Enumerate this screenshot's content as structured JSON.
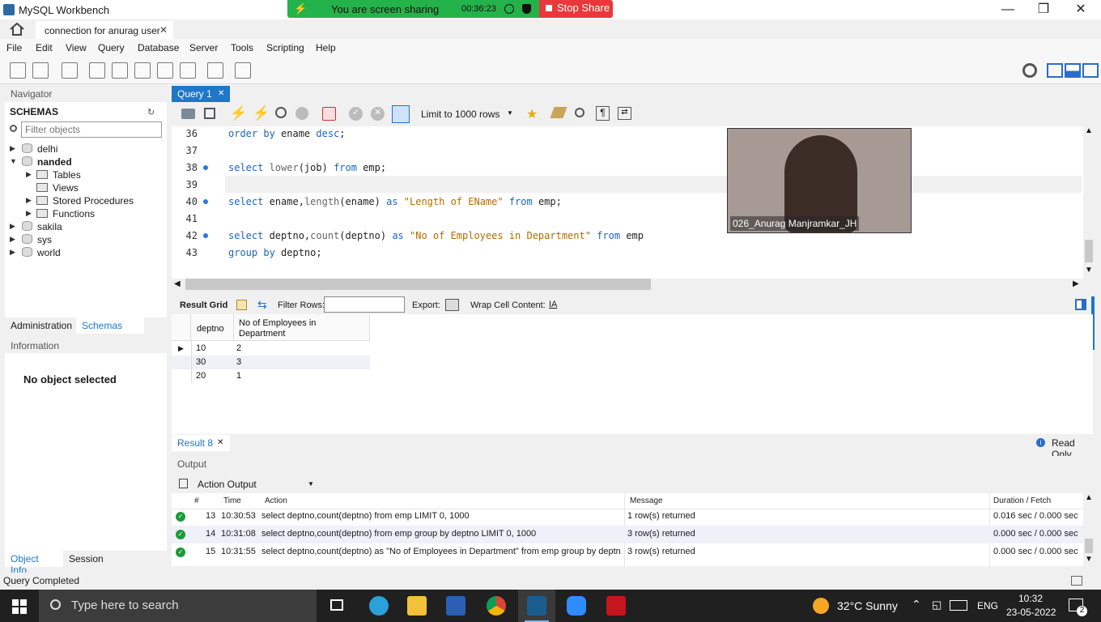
{
  "window": {
    "title": "MySQL Workbench",
    "tab_label": "connection for anurag user"
  },
  "share_banner": {
    "message": "You are screen sharing",
    "elapsed": "00:36:23",
    "stop_label": "Stop Share"
  },
  "menu": [
    "File",
    "Edit",
    "View",
    "Query",
    "Database",
    "Server",
    "Tools",
    "Scripting",
    "Help"
  ],
  "navigator": {
    "title": "Navigator",
    "schemas_label": "SCHEMAS",
    "filter_placeholder": "Filter objects",
    "schemas": [
      "delhi",
      "nanded",
      "sakila",
      "sys",
      "world"
    ],
    "nanded_children": [
      "Tables",
      "Views",
      "Stored Procedures",
      "Functions"
    ],
    "tabs": [
      "Administration",
      "Schemas"
    ],
    "info_title": "Information",
    "no_object": "No object selected",
    "bottom_tabs": [
      "Object Info",
      "Session"
    ]
  },
  "editor": {
    "tab_label": "Query 1",
    "limit_label": "Limit to 1000 rows",
    "line_numbers": [
      "36",
      "37",
      "38",
      "39",
      "40",
      "41",
      "42",
      "43"
    ],
    "lines": {
      "l36a": "order by",
      "l36b": " ename ",
      "l36c": "desc",
      "l36d": ";",
      "l38a": "select ",
      "l38b": "lower",
      "l38c": "(job) ",
      "l38d": "from",
      "l38e": " emp;",
      "l40a": "select ",
      "l40b": "ename,",
      "l40c": "length",
      "l40d": "(ename) ",
      "l40e": "as",
      "l40f": " \"Length of EName\" ",
      "l40g": "from",
      "l40h": " emp;",
      "l42a": "select ",
      "l42b": "deptno,",
      "l42c": "count",
      "l42d": "(deptno) ",
      "l42e": "as",
      "l42f": " \"No of Employees in Department\" ",
      "l42g": "from",
      "l42h": " emp",
      "l43a": "group by",
      "l43b": " deptno;"
    }
  },
  "video": {
    "name": "026_Anurag Manjramkar_JH"
  },
  "result_toolbar": {
    "grid_label": "Result Grid",
    "filter_label": "Filter Rows:",
    "export_label": "Export:",
    "wrap_label": "Wrap Cell Content:"
  },
  "result_grid": {
    "columns": [
      "deptno",
      "No of Employees in Department"
    ],
    "rows": [
      [
        "10",
        "2"
      ],
      [
        "30",
        "3"
      ],
      [
        "20",
        "1"
      ]
    ]
  },
  "result_tab": {
    "label": "Result 8",
    "read_only": "Read Only"
  },
  "output": {
    "title": "Output",
    "selector": "Action Output",
    "headers": [
      "#",
      "Time",
      "Action",
      "Message",
      "Duration / Fetch"
    ],
    "rows": [
      {
        "n": "13",
        "time": "10:30:53",
        "action": "select deptno,count(deptno) from emp LIMIT 0, 1000",
        "message": "1 row(s) returned",
        "duration": "0.016 sec / 0.000 sec"
      },
      {
        "n": "14",
        "time": "10:31:08",
        "action": "select deptno,count(deptno) from emp group by deptno LIMIT 0, 1000",
        "message": "3 row(s) returned",
        "duration": "0.000 sec / 0.000 sec"
      },
      {
        "n": "15",
        "time": "10:31:55",
        "action": "select deptno,count(deptno) as \"No of Employees in Department\" from emp group by deptn...",
        "message": "3 row(s) returned",
        "duration": "0.000 sec / 0.000 sec"
      }
    ]
  },
  "status": "Query Completed",
  "taskbar": {
    "search_placeholder": "Type here to search",
    "weather": "32°C  Sunny",
    "lang": "ENG",
    "time": "10:32",
    "date": "23-05-2022",
    "notifications": "2"
  },
  "colors": {
    "accent": "#1e77c8",
    "share_green": "#24b24b",
    "share_red": "#e8383b",
    "keyword": "#1c63c4",
    "string": "#b26b00"
  }
}
